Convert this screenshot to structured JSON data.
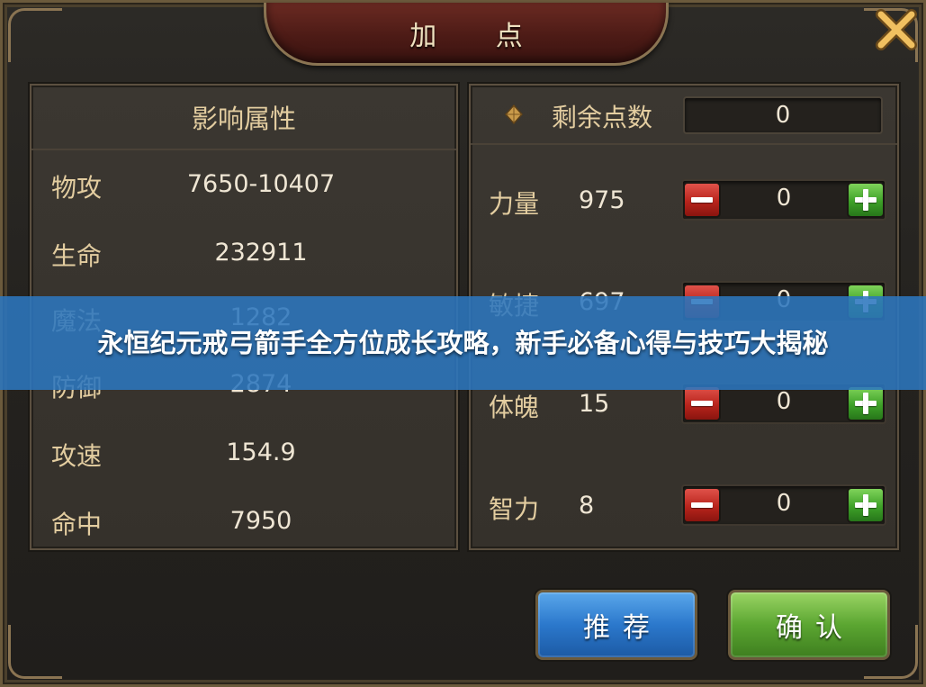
{
  "dialog": {
    "title": "加 点",
    "close_icon": "close-x-icon"
  },
  "influence": {
    "header": "影响属性",
    "stats": [
      {
        "label": "物攻",
        "value": "7650-10407"
      },
      {
        "label": "生命",
        "value": "232911"
      },
      {
        "label": "魔法",
        "value": "1282"
      },
      {
        "label": "防御",
        "value": "2874"
      },
      {
        "label": "攻速",
        "value": "154.9"
      },
      {
        "label": "命中",
        "value": "7950"
      }
    ]
  },
  "allocation": {
    "remaining_label": "剩余点数",
    "remaining_value": "0",
    "remaining_icon": "diamond-icon",
    "attributes": [
      {
        "label": "力量",
        "value": "975",
        "added": "0"
      },
      {
        "label": "敏捷",
        "value": "697",
        "added": "0"
      },
      {
        "label": "体魄",
        "value": "15",
        "added": "0"
      },
      {
        "label": "智力",
        "value": "8",
        "added": "0"
      }
    ]
  },
  "buttons": {
    "recommend": "推荐",
    "confirm": "确认"
  },
  "banner": {
    "text": "永恒纪元戒弓箭手全方位成长攻略，新手必备心得与技巧大揭秘"
  },
  "colors": {
    "label_gold": "#e3cda0",
    "value_white": "#efe6d4",
    "minus_red": "#b8241c",
    "plus_green": "#3ea128",
    "recommend_blue": "#2b78cc",
    "confirm_green": "#5ba631",
    "banner_blue": "#2c76be"
  }
}
